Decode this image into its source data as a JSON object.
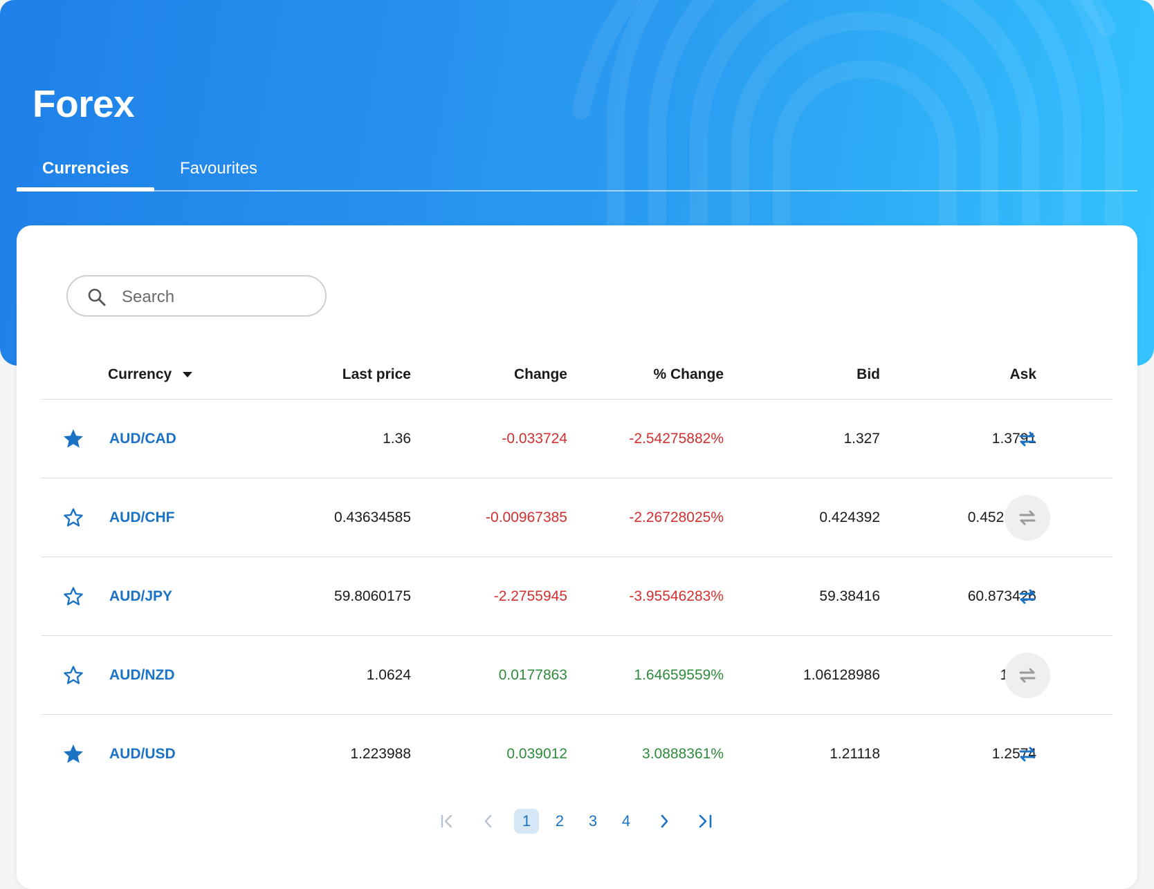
{
  "page": {
    "title": "Forex",
    "tabs": [
      {
        "label": "Currencies",
        "active": true
      },
      {
        "label": "Favourites",
        "active": false
      }
    ]
  },
  "search": {
    "placeholder": "Search",
    "value": ""
  },
  "table": {
    "columns": [
      "Currency",
      "Last price",
      "Change",
      "% Change",
      "Bid",
      "Ask"
    ],
    "sort": {
      "column": "Currency",
      "direction": "descending-caret"
    },
    "rows": [
      {
        "favourite": true,
        "pair": "AUD/CAD",
        "last": "1.36",
        "change": "-0.033724",
        "pct": "-2.54275882%",
        "bid": "1.327",
        "ask": "1.3791",
        "trend": "negative"
      },
      {
        "favourite": false,
        "pair": "AUD/CHF",
        "last": "0.43634585",
        "change": "-0.00967385",
        "pct": "-2.26728025%",
        "bid": "0.424392",
        "ask": "0.4529052",
        "trend": "negative"
      },
      {
        "favourite": false,
        "pair": "AUD/JPY",
        "last": "59.8060175",
        "change": "-2.2755945",
        "pct": "-3.95546283%",
        "bid": "59.38416",
        "ask": "60.873426",
        "trend": "negative"
      },
      {
        "favourite": false,
        "pair": "AUD/NZD",
        "last": "1.0624",
        "change": "0.0177863",
        "pct": "1.64659559%",
        "bid": "1.06128986",
        "ask": "1.095",
        "trend": "positive"
      },
      {
        "favourite": true,
        "pair": "AUD/USD",
        "last": "1.223988",
        "change": "0.039012",
        "pct": "3.0888361%",
        "bid": "1.21118",
        "ask": "1.2574",
        "trend": "positive"
      }
    ]
  },
  "pagination": {
    "pages": [
      "1",
      "2",
      "3",
      "4"
    ],
    "current": "1",
    "icons": [
      "first-page-icon",
      "previous-page-icon",
      "next-page-icon",
      "last-page-icon"
    ]
  },
  "colors": {
    "accent": "#1a72c4",
    "negative": "#d32f2f",
    "positive": "#2e8b3a",
    "hero_start": "#1f80e8",
    "hero_end": "#34c3ff"
  }
}
